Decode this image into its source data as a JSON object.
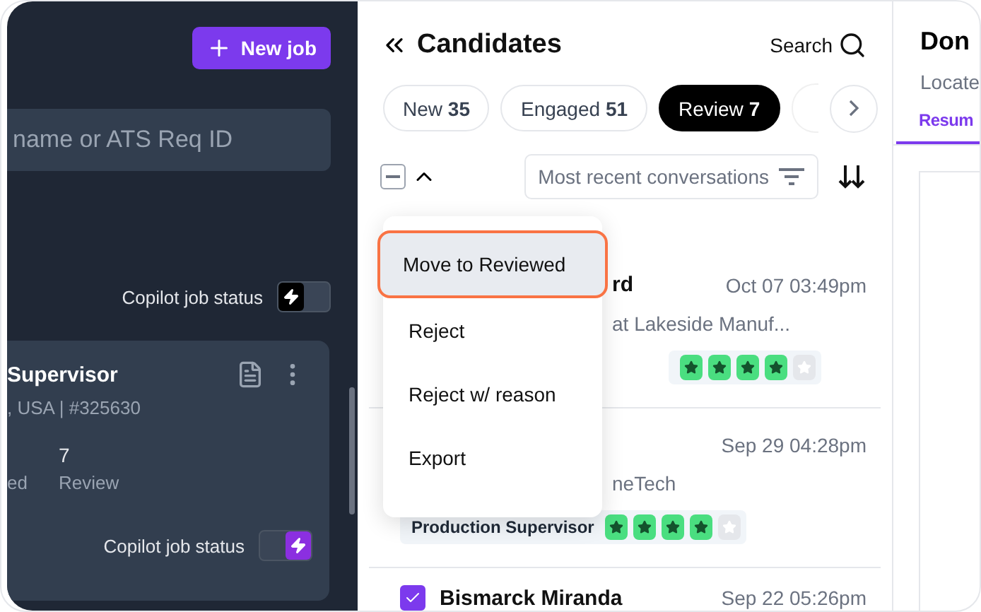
{
  "sidebar": {
    "new_job_button": "New job",
    "search": {
      "placeholder": "name or ATS Req ID"
    },
    "copilot_rows": [
      {
        "label": "Copilot job status",
        "on": false
      }
    ],
    "job_card": {
      "title": "Supervisor",
      "subtitle": ", USA | #325630",
      "stats": [
        {
          "label": "ed"
        },
        {
          "value": "7",
          "label": "Review"
        }
      ],
      "copilot": {
        "label": "Copilot job status",
        "on": true
      }
    }
  },
  "candidates": {
    "title": "Candidates",
    "search_label": "Search",
    "tabs": [
      {
        "label": "New",
        "count": "35",
        "selected": false
      },
      {
        "label": "Engaged",
        "count": "51",
        "selected": false
      },
      {
        "label": "Review",
        "count": "7",
        "selected": true
      }
    ],
    "select_all": {
      "indeterminate": true
    },
    "sort_label": "Most recent conversations",
    "rows": [
      {
        "kind": "covered",
        "name": "rd",
        "date": "Oct 07 03:49pm",
        "subtitle": "at Lakeside Manuf...",
        "stars": 4
      },
      {
        "kind": "covered",
        "date": "Sep 29 04:28pm",
        "subtitle": "neTech",
        "tag": "Production Supervisor",
        "stars": 4
      },
      {
        "kind": "full",
        "checked": true,
        "name": "Bismarck Miranda",
        "date": "Sep 22 05:26pm"
      }
    ],
    "menu": [
      {
        "label": "Move to Reviewed",
        "selected": true
      },
      {
        "label": "Reject",
        "selected": false
      },
      {
        "label": "Reject w/ reason",
        "selected": false
      },
      {
        "label": "Export",
        "selected": false
      }
    ]
  },
  "detail": {
    "title": "Don",
    "subtitle": "Locate",
    "tab": "Resum"
  }
}
